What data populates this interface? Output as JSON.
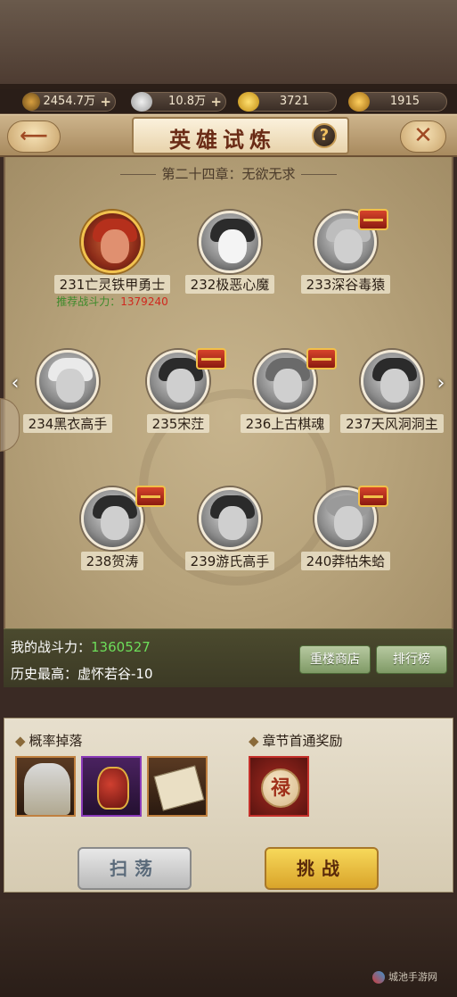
{
  "currency": {
    "copper": "2454.7万",
    "silver": "10.8万",
    "gold": "3721",
    "locked_gold": "1915"
  },
  "header": {
    "title": "英雄试炼"
  },
  "chapter": "第二十四章：无欲无求",
  "nodes": [
    {
      "label": "231亡灵铁甲勇士"
    },
    {
      "label": "232极恶心魔"
    },
    {
      "label": "233深谷毒猿"
    },
    {
      "label": "234黑衣高手"
    },
    {
      "label": "235宋茳"
    },
    {
      "label": "236上古棋魂"
    },
    {
      "label": "237天风洞洞主"
    },
    {
      "label": "238贺涛"
    },
    {
      "label": "239游氏高手"
    },
    {
      "label": "240莽牯朱蛤"
    }
  ],
  "recommended": {
    "label": "推荐战斗力：",
    "value": "1379240"
  },
  "stats": {
    "power_label": "我的战斗力：",
    "power_value": "1360527",
    "best_label": "历史最高：",
    "best_value": "虚怀若谷-10"
  },
  "buttons": {
    "shop": "重楼商店",
    "rank": "排行榜",
    "sweep": "扫荡",
    "challenge": "挑战"
  },
  "drops": {
    "title": "概率掉落"
  },
  "rewards": {
    "title": "章节首通奖励",
    "coin_char": "禄"
  },
  "watermark": "城池手游网"
}
